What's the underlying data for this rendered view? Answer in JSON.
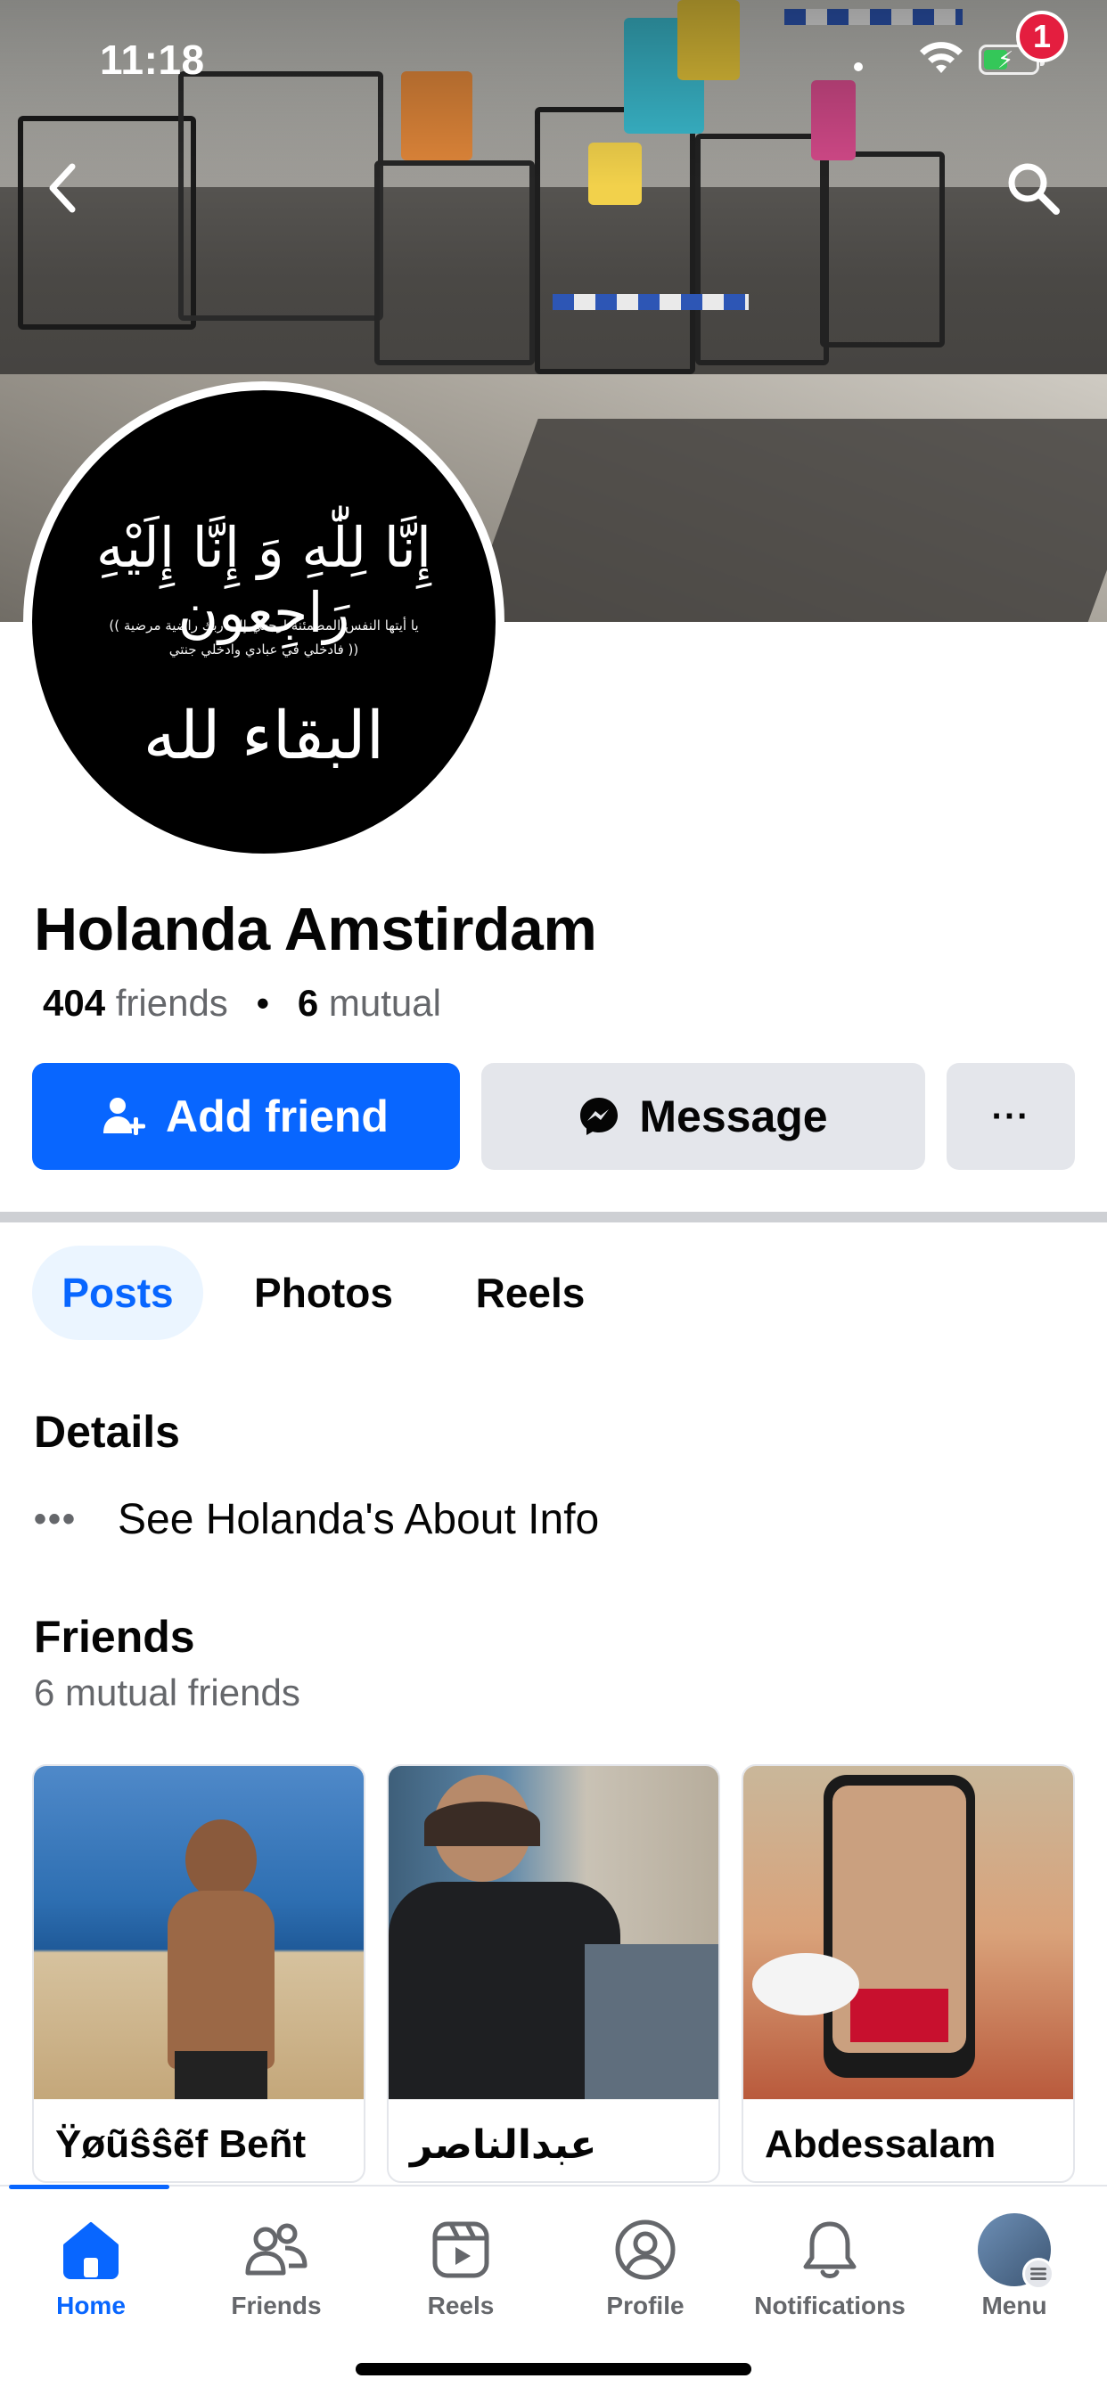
{
  "status_bar": {
    "time": "11:18"
  },
  "profile": {
    "name": "Holanda Amstirdam",
    "friends_count": "404",
    "friends_label": "friends",
    "mutual_count": "6",
    "mutual_label": "mutual",
    "avatar_text": {
      "line1": "إِنَّا لِلّٰهِ وَ إِنَّا إِلَيْهِ رَاجِعون",
      "line2": "(( يا أيتها النفس المطمئنة ارجعي إلى ربك راضية مرضية",
      "line3": "فادخلي في عبادي وادخلي جنتي ))",
      "line4": "البقاء لله"
    }
  },
  "actions": {
    "add_friend": "Add friend",
    "message": "Message",
    "more": "···"
  },
  "tabs": [
    {
      "label": "Posts",
      "active": true
    },
    {
      "label": "Photos",
      "active": false
    },
    {
      "label": "Reels",
      "active": false
    }
  ],
  "details": {
    "title": "Details",
    "about_link": "See Holanda's About Info"
  },
  "friends": {
    "title": "Friends",
    "subtitle": "6 mutual friends",
    "items": [
      {
        "name": "Ÿøũŝŝẽf Beñt"
      },
      {
        "name": "عبدالناصر"
      },
      {
        "name": "Abdessalam"
      }
    ]
  },
  "bottom_nav": [
    {
      "label": "Home",
      "icon": "home-icon",
      "active": true
    },
    {
      "label": "Friends",
      "icon": "friends-icon",
      "active": false
    },
    {
      "label": "Reels",
      "icon": "reels-icon",
      "active": false
    },
    {
      "label": "Profile",
      "icon": "profile-icon",
      "active": false
    },
    {
      "label": "Notifications",
      "icon": "bell-icon",
      "active": false
    },
    {
      "label": "Menu",
      "icon": "menu-avatar",
      "active": false,
      "badge": "1"
    }
  ],
  "colors": {
    "accent": "#0866ff",
    "secondary_button": "#e4e6eb",
    "badge": "#e41e3f",
    "muted_text": "#65676b"
  }
}
